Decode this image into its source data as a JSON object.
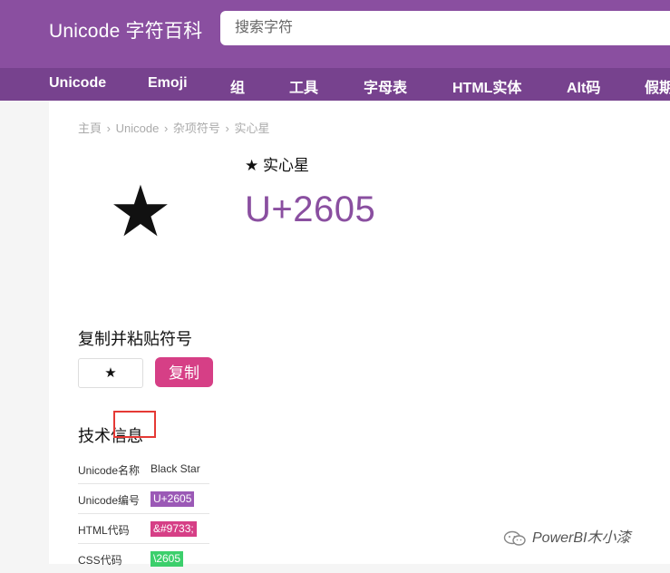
{
  "header": {
    "logo": "Unicode 字符百科",
    "search_placeholder": "搜索字符"
  },
  "nav": {
    "items": [
      {
        "label": "Unicode"
      },
      {
        "label": "Emoji"
      },
      {
        "label": "组"
      },
      {
        "label": "工具"
      },
      {
        "label": "字母表"
      },
      {
        "label": "HTML实体"
      },
      {
        "label": "Alt码"
      },
      {
        "label": "假期"
      }
    ]
  },
  "breadcrumb": [
    "主頁",
    "Unicode",
    "杂项符号",
    "实心星"
  ],
  "breadcrumb_separator": "›",
  "character": {
    "glyph": "★",
    "title": "★ 实心星",
    "code": "U+2605"
  },
  "copy_section": {
    "title": "复制并粘贴符号",
    "value": "★",
    "button_label": "复制"
  },
  "tech_info": {
    "title": "技术信息",
    "rows": [
      {
        "label": "Unicode名称",
        "value": "Black Star"
      },
      {
        "label": "Unicode编号",
        "value": "U+2605"
      },
      {
        "label": "HTML代码",
        "value": "&#9733;"
      },
      {
        "label": "CSS代码",
        "value": "\\2605"
      }
    ]
  },
  "watermark": {
    "text": "PowerBI木小漆"
  },
  "colors": {
    "header_bg": "#8a4fa0",
    "nav_bg": "#77428e",
    "accent": "#8a4fa0",
    "copy_button": "#d63f86",
    "tag_purple": "#9b59b6",
    "tag_pink": "#d63f86",
    "tag_green": "#3ccf6c",
    "highlight": "#e53935"
  }
}
